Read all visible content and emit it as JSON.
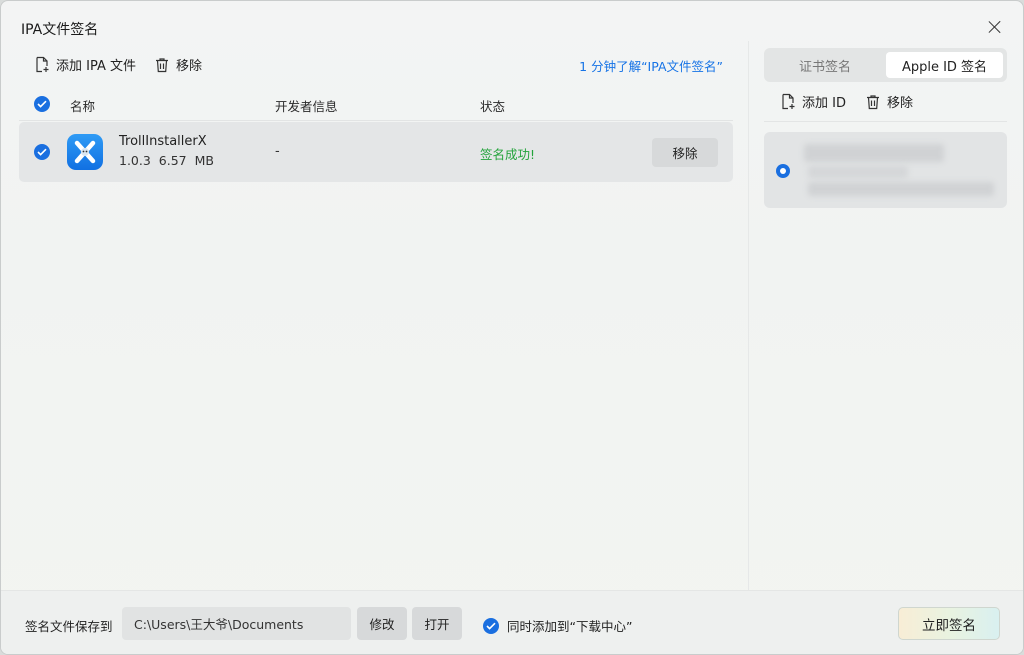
{
  "window": {
    "title": "IPA文件签名"
  },
  "toolbar": {
    "add_label": "添加 IPA 文件",
    "remove_label": "移除",
    "help_link": "1 分钟了解“IPA文件签名”"
  },
  "table": {
    "headers": {
      "name": "名称",
      "developer": "开发者信息",
      "status": "状态"
    },
    "rows": [
      {
        "name": "TrollInstallerX",
        "version": "1.0.3",
        "size": "6.57 MB",
        "developer": "-",
        "status": "签名成功!",
        "action": "移除"
      }
    ]
  },
  "right_panel": {
    "tabs": [
      {
        "label": "证书签名",
        "active": false
      },
      {
        "label": "Apple ID 签名",
        "active": true
      }
    ],
    "add_id_label": "添加 ID",
    "remove_label": "移除"
  },
  "footer": {
    "save_label": "签名文件保存到",
    "save_path": "C:\\Users\\王大爷\\Documents",
    "modify_label": "修改",
    "open_label": "打开",
    "sync_label": "同时添加到“下载中心”",
    "sign_label": "立即签名"
  },
  "colors": {
    "accent": "#1a6fe0",
    "success": "#23a33b",
    "link": "#1673e6"
  }
}
